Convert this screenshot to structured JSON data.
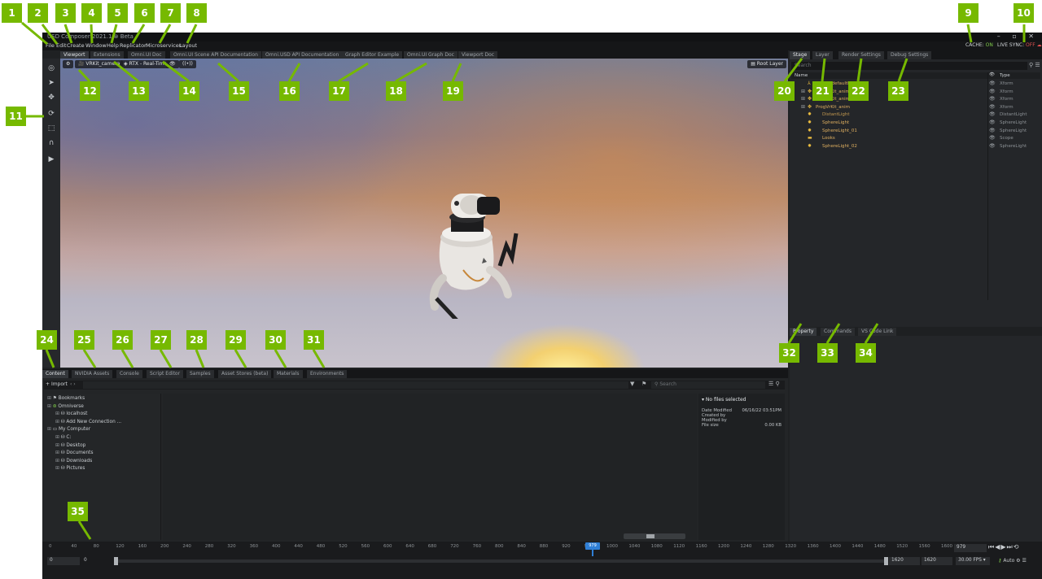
{
  "window": {
    "title": "USD Composer 2021.1 ⊗ Beta",
    "cache_label": "CACHE:",
    "cache_value": "ON",
    "live_sync_label": "LIVE SYNC:",
    "live_sync_value": "OFF",
    "colors": {
      "accent_green": "#76b900",
      "on": "#7ec94a",
      "off": "#e05050"
    }
  },
  "menu": [
    "File",
    "Edit",
    "Create",
    "Window",
    "Help",
    "Replicator",
    "Microservices",
    "Layout"
  ],
  "viewport_tabs": [
    "Viewport",
    "Extensions",
    "Omni.UI Doc",
    "Omni.UI Scene API Documentation",
    "Omni.USD API Documentation",
    "Graph Editor Example",
    "Omni.UI Graph Doc",
    "Viewport Doc"
  ],
  "viewport": {
    "camera": "VRKit_camera",
    "renderer": "RTX - Real-Time",
    "root_layer": "Root Layer",
    "overlay_icon": "((•))"
  },
  "right_tabs": [
    "Stage",
    "Layer",
    "Render Settings",
    "Debug Settings"
  ],
  "stage": {
    "search_placeholder": "Search",
    "col_name": "Name",
    "col_type": "Type",
    "rows": [
      {
        "name": "World (defaultPrim)",
        "type": "Xform"
      },
      {
        "name": "ProgVrKit_anim",
        "type": "Xform"
      },
      {
        "name": "ProgVrKit_anim",
        "type": "Xform"
      },
      {
        "name": "ProgVrKit_anim",
        "type": "Xform"
      },
      {
        "name": "DistantLight",
        "type": "DistantLight"
      },
      {
        "name": "SphereLight",
        "type": "SphereLight"
      },
      {
        "name": "SphereLight_01",
        "type": "SphereLight"
      },
      {
        "name": "Looks",
        "type": "Scope"
      },
      {
        "name": "SphereLight_02",
        "type": "SphereLight"
      }
    ]
  },
  "property_tabs": [
    "Property",
    "Commands",
    "VS Code Link"
  ],
  "bottom_tabs": [
    "Content",
    "NVIDIA Assets",
    "Console",
    "Script Editor",
    "Samples",
    "Asset Stores (beta)",
    "Materials",
    "Environments"
  ],
  "content": {
    "import_label": "Import",
    "search_placeholder": "Search",
    "tree": [
      {
        "label": "Bookmarks",
        "level": 0
      },
      {
        "label": "Omniverse",
        "level": 0
      },
      {
        "label": "localhost",
        "level": 1
      },
      {
        "label": "Add New Connection ...",
        "level": 1
      },
      {
        "label": "My Computer",
        "level": 0
      },
      {
        "label": "C:",
        "level": 1
      },
      {
        "label": "Desktop",
        "level": 1
      },
      {
        "label": "Documents",
        "level": 1
      },
      {
        "label": "Downloads",
        "level": 1
      },
      {
        "label": "Pictures",
        "level": 1
      }
    ],
    "detail_title": "No files selected",
    "detail_rows": [
      {
        "label": "Date Modified",
        "value": "06/16/22 03:51PM"
      },
      {
        "label": "Created by",
        "value": ""
      },
      {
        "label": "Modified by",
        "value": ""
      },
      {
        "label": "File size",
        "value": "0.00 KB"
      }
    ]
  },
  "timeline": {
    "ticks": [
      "0",
      "40",
      "80",
      "120",
      "160",
      "200",
      "240",
      "280",
      "320",
      "360",
      "400",
      "440",
      "480",
      "520",
      "560",
      "600",
      "640",
      "680",
      "720",
      "760",
      "800",
      "840",
      "880",
      "920",
      "960",
      "1000",
      "1040",
      "1080",
      "1120",
      "1160",
      "1200",
      "1240",
      "1280",
      "1320",
      "1360",
      "1400",
      "1440",
      "1480",
      "1520",
      "1560",
      "1600"
    ],
    "current_frame": "979",
    "playhead_label": "979",
    "start": "0",
    "range_start": "0",
    "range_end": "1620",
    "end": "1620",
    "fps": "30.00 FPS",
    "auto_label": "Auto"
  },
  "callouts": [
    "1",
    "2",
    "3",
    "4",
    "5",
    "6",
    "7",
    "8",
    "9",
    "10",
    "11",
    "12",
    "13",
    "14",
    "15",
    "16",
    "17",
    "18",
    "19",
    "20",
    "21",
    "22",
    "23",
    "24",
    "25",
    "26",
    "27",
    "28",
    "29",
    "30",
    "31",
    "32",
    "33",
    "34",
    "35"
  ]
}
